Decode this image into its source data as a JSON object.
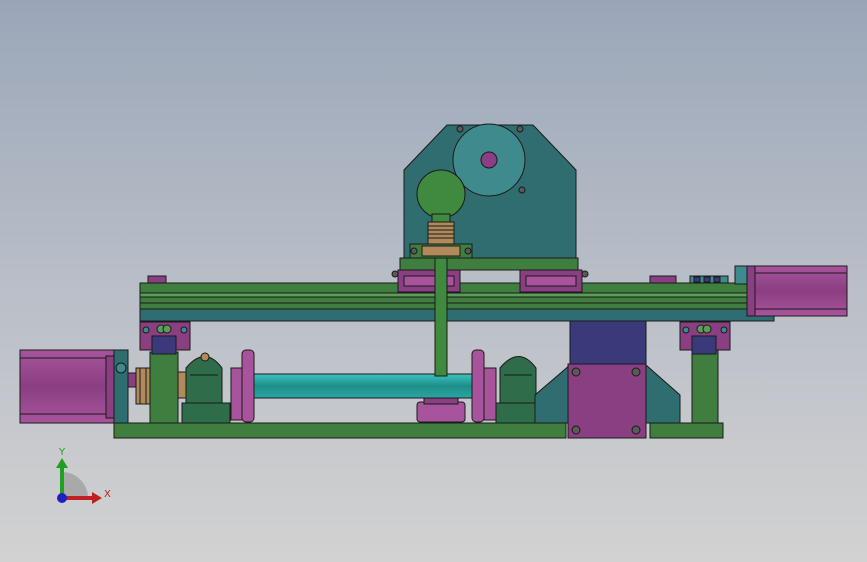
{
  "viewport": {
    "background_top": "#9aa6b8",
    "background_bottom": "#d2d2d2"
  },
  "colors": {
    "motor_body": "#8a3f82",
    "motor_light": "#a8549c",
    "teal_plate": "#2f6d70",
    "teal_light": "#3f8a8c",
    "green_frame": "#3f7e3f",
    "green_light": "#5a9e5a",
    "shaft": "#2aa6a2",
    "navy_block": "#3a3a7a",
    "edge": "#1a1a1a"
  },
  "triad": {
    "x_label": "X",
    "y_label": "Y",
    "x_color": "#c02020",
    "y_color": "#20a020"
  }
}
